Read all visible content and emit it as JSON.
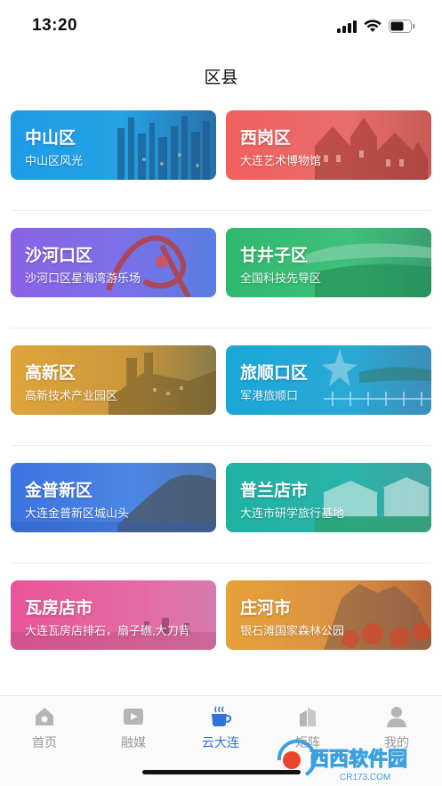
{
  "status_bar": {
    "time": "13:20"
  },
  "header": {
    "title": "区县"
  },
  "districts": [
    {
      "name": "中山区",
      "desc": "中山区风光"
    },
    {
      "name": "西岗区",
      "desc": "大连艺术博物馆"
    },
    {
      "name": "沙河口区",
      "desc": "沙河口区星海湾游乐场"
    },
    {
      "name": "甘井子区",
      "desc": "全国科技先导区"
    },
    {
      "name": "高新区",
      "desc": "高新技术产业园区"
    },
    {
      "name": "旅顺口区",
      "desc": "军港旅顺口"
    },
    {
      "name": "金普新区",
      "desc": "大连金普新区城山头"
    },
    {
      "name": "普兰店市",
      "desc": "大连市研学旅行基地"
    },
    {
      "name": "瓦房店市",
      "desc": "大连瓦房店排石，扇子礁,大刀背"
    },
    {
      "name": "庄河市",
      "desc": "银石滩国家森林公园"
    }
  ],
  "tabbar": {
    "items": [
      {
        "label": "首页",
        "icon": "home-icon"
      },
      {
        "label": "融媒",
        "icon": "media-play-icon"
      },
      {
        "label": "云大连",
        "icon": "coffee-cup-icon",
        "active": true
      },
      {
        "label": "矩阵",
        "icon": "buildings-icon"
      },
      {
        "label": "我的",
        "icon": "user-icon"
      }
    ]
  },
  "watermark": {
    "text_cn": "西西软件园",
    "text_en": "CR173.COM"
  },
  "colors": {
    "accent": "#2f73d8",
    "tab_inactive": "#9a9a9a"
  }
}
